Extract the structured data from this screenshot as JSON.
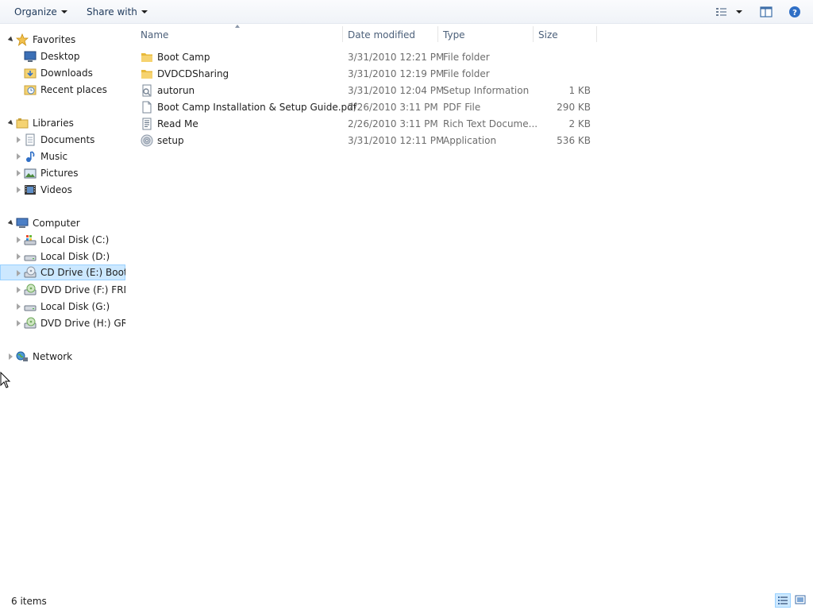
{
  "toolbar": {
    "organize_label": "Organize",
    "share_label": "Share with",
    "icons": [
      "view-options-icon",
      "preview-pane-icon",
      "help-icon"
    ]
  },
  "nav": {
    "favorites": {
      "label": "Favorites",
      "items": [
        {
          "label": "Desktop",
          "icon": "desktop-icon"
        },
        {
          "label": "Downloads",
          "icon": "downloads-icon"
        },
        {
          "label": "Recent places",
          "icon": "recent-places-icon"
        }
      ]
    },
    "libraries": {
      "label": "Libraries",
      "items": [
        {
          "label": "Documents",
          "icon": "documents-icon"
        },
        {
          "label": "Music",
          "icon": "music-icon"
        },
        {
          "label": "Pictures",
          "icon": "pictures-icon"
        },
        {
          "label": "Videos",
          "icon": "videos-icon"
        }
      ]
    },
    "computer": {
      "label": "Computer",
      "items": [
        {
          "label": "Local Disk (C:)",
          "icon": "system-drive-icon"
        },
        {
          "label": "Local Disk (D:)",
          "icon": "hard-drive-icon"
        },
        {
          "label": "CD Drive (E:) Boot Camp",
          "icon": "cd-drive-icon",
          "selected": true
        },
        {
          "label": "DVD Drive (F:) FRMB",
          "icon": "dvd-drive-icon"
        },
        {
          "label": "Local Disk (G:)",
          "icon": "hard-drive-icon"
        },
        {
          "label": "DVD Drive (H:) GRM",
          "icon": "dvd-drive-icon"
        }
      ]
    },
    "network": {
      "label": "Network"
    }
  },
  "columns": {
    "name": "Name",
    "date_modified": "Date modified",
    "type": "Type",
    "size": "Size"
  },
  "files": [
    {
      "name": "Boot Camp",
      "date": "3/31/2010 12:21 PM",
      "type": "File folder",
      "size": "",
      "icon": "folder-icon"
    },
    {
      "name": "DVDCDSharing",
      "date": "3/31/2010 12:19 PM",
      "type": "File folder",
      "size": "",
      "icon": "folder-icon"
    },
    {
      "name": "autorun",
      "date": "3/31/2010 12:04 PM",
      "type": "Setup Information",
      "size": "1 KB",
      "icon": "setup-info-icon"
    },
    {
      "name": "Boot Camp Installation & Setup Guide.pdf",
      "date": "2/26/2010 3:11 PM",
      "type": "PDF File",
      "size": "290 KB",
      "icon": "pdf-file-icon"
    },
    {
      "name": "Read Me",
      "date": "2/26/2010 3:11 PM",
      "type": "Rich Text Docume...",
      "size": "2 KB",
      "icon": "rich-text-icon"
    },
    {
      "name": "setup",
      "date": "3/31/2010 12:11 PM",
      "type": "Application",
      "size": "536 KB",
      "icon": "application-icon"
    }
  ],
  "status": {
    "item_count": "6 items"
  }
}
